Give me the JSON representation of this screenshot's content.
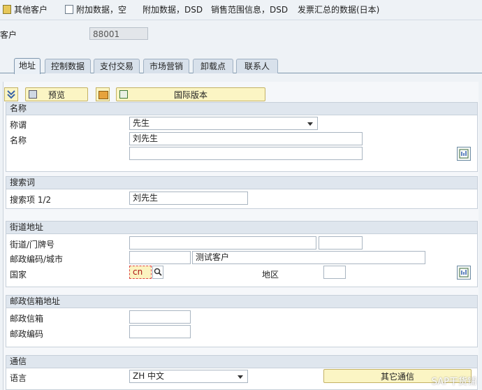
{
  "toolbar": {
    "other_customer": "其他客户",
    "addl_data_empty": "附加数据，空",
    "addl_data_dsd": "附加数据，DSD",
    "sales_area_dsd": "销售范围信息，DSD",
    "invoice_summary": "发票汇总的数据(日本)"
  },
  "customer": {
    "label": "客户",
    "value": "88001"
  },
  "tabs": [
    "地址",
    "控制数据",
    "支付交易",
    "市场营销",
    "卸载点",
    "联系人"
  ],
  "actions": {
    "preview": "预览",
    "intl_version": "国际版本"
  },
  "name_section": {
    "title": "名称",
    "salutation_label": "称谓",
    "salutation_value": "先生",
    "name_label": "名称",
    "name_value": "刘先生",
    "name2_value": ""
  },
  "search_section": {
    "title": "搜索词",
    "search_label": "搜索项 1/2",
    "search_value": "刘先生"
  },
  "street_section": {
    "title": "街道地址",
    "street_label": "街道/门牌号",
    "postal_city_label": "邮政编码/城市",
    "city_value": "测试客户",
    "country_label": "国家",
    "country_value": "cn",
    "region_label": "地区"
  },
  "pobox_section": {
    "title": "邮政信箱地址",
    "pobox_label": "邮政信箱",
    "postal_label": "邮政编码"
  },
  "comm_section": {
    "title": "通信",
    "language_label": "语言",
    "language_value": "ZH 中文",
    "other_comm": "其它通信"
  },
  "watermark": "SAP干货铺"
}
